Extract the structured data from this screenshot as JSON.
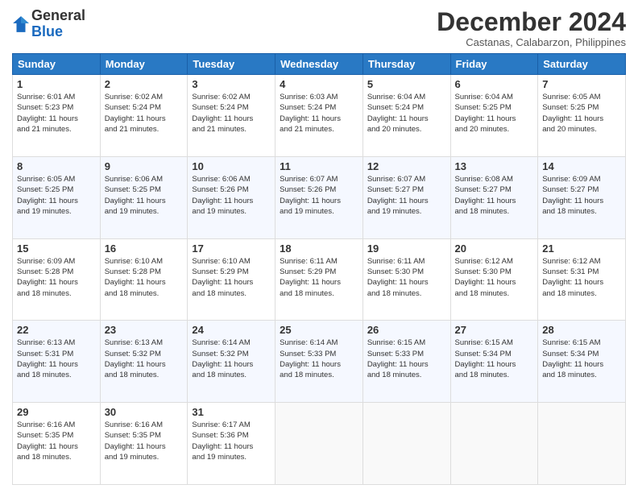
{
  "logo": {
    "general": "General",
    "blue": "Blue"
  },
  "title": "December 2024",
  "location": "Castanas, Calabarzon, Philippines",
  "header_days": [
    "Sunday",
    "Monday",
    "Tuesday",
    "Wednesday",
    "Thursday",
    "Friday",
    "Saturday"
  ],
  "weeks": [
    [
      {
        "day": "1",
        "info": "Sunrise: 6:01 AM\nSunset: 5:23 PM\nDaylight: 11 hours\nand 21 minutes."
      },
      {
        "day": "2",
        "info": "Sunrise: 6:02 AM\nSunset: 5:24 PM\nDaylight: 11 hours\nand 21 minutes."
      },
      {
        "day": "3",
        "info": "Sunrise: 6:02 AM\nSunset: 5:24 PM\nDaylight: 11 hours\nand 21 minutes."
      },
      {
        "day": "4",
        "info": "Sunrise: 6:03 AM\nSunset: 5:24 PM\nDaylight: 11 hours\nand 21 minutes."
      },
      {
        "day": "5",
        "info": "Sunrise: 6:04 AM\nSunset: 5:24 PM\nDaylight: 11 hours\nand 20 minutes."
      },
      {
        "day": "6",
        "info": "Sunrise: 6:04 AM\nSunset: 5:25 PM\nDaylight: 11 hours\nand 20 minutes."
      },
      {
        "day": "7",
        "info": "Sunrise: 6:05 AM\nSunset: 5:25 PM\nDaylight: 11 hours\nand 20 minutes."
      }
    ],
    [
      {
        "day": "8",
        "info": "Sunrise: 6:05 AM\nSunset: 5:25 PM\nDaylight: 11 hours\nand 19 minutes."
      },
      {
        "day": "9",
        "info": "Sunrise: 6:06 AM\nSunset: 5:25 PM\nDaylight: 11 hours\nand 19 minutes."
      },
      {
        "day": "10",
        "info": "Sunrise: 6:06 AM\nSunset: 5:26 PM\nDaylight: 11 hours\nand 19 minutes."
      },
      {
        "day": "11",
        "info": "Sunrise: 6:07 AM\nSunset: 5:26 PM\nDaylight: 11 hours\nand 19 minutes."
      },
      {
        "day": "12",
        "info": "Sunrise: 6:07 AM\nSunset: 5:27 PM\nDaylight: 11 hours\nand 19 minutes."
      },
      {
        "day": "13",
        "info": "Sunrise: 6:08 AM\nSunset: 5:27 PM\nDaylight: 11 hours\nand 18 minutes."
      },
      {
        "day": "14",
        "info": "Sunrise: 6:09 AM\nSunset: 5:27 PM\nDaylight: 11 hours\nand 18 minutes."
      }
    ],
    [
      {
        "day": "15",
        "info": "Sunrise: 6:09 AM\nSunset: 5:28 PM\nDaylight: 11 hours\nand 18 minutes."
      },
      {
        "day": "16",
        "info": "Sunrise: 6:10 AM\nSunset: 5:28 PM\nDaylight: 11 hours\nand 18 minutes."
      },
      {
        "day": "17",
        "info": "Sunrise: 6:10 AM\nSunset: 5:29 PM\nDaylight: 11 hours\nand 18 minutes."
      },
      {
        "day": "18",
        "info": "Sunrise: 6:11 AM\nSunset: 5:29 PM\nDaylight: 11 hours\nand 18 minutes."
      },
      {
        "day": "19",
        "info": "Sunrise: 6:11 AM\nSunset: 5:30 PM\nDaylight: 11 hours\nand 18 minutes."
      },
      {
        "day": "20",
        "info": "Sunrise: 6:12 AM\nSunset: 5:30 PM\nDaylight: 11 hours\nand 18 minutes."
      },
      {
        "day": "21",
        "info": "Sunrise: 6:12 AM\nSunset: 5:31 PM\nDaylight: 11 hours\nand 18 minutes."
      }
    ],
    [
      {
        "day": "22",
        "info": "Sunrise: 6:13 AM\nSunset: 5:31 PM\nDaylight: 11 hours\nand 18 minutes."
      },
      {
        "day": "23",
        "info": "Sunrise: 6:13 AM\nSunset: 5:32 PM\nDaylight: 11 hours\nand 18 minutes."
      },
      {
        "day": "24",
        "info": "Sunrise: 6:14 AM\nSunset: 5:32 PM\nDaylight: 11 hours\nand 18 minutes."
      },
      {
        "day": "25",
        "info": "Sunrise: 6:14 AM\nSunset: 5:33 PM\nDaylight: 11 hours\nand 18 minutes."
      },
      {
        "day": "26",
        "info": "Sunrise: 6:15 AM\nSunset: 5:33 PM\nDaylight: 11 hours\nand 18 minutes."
      },
      {
        "day": "27",
        "info": "Sunrise: 6:15 AM\nSunset: 5:34 PM\nDaylight: 11 hours\nand 18 minutes."
      },
      {
        "day": "28",
        "info": "Sunrise: 6:15 AM\nSunset: 5:34 PM\nDaylight: 11 hours\nand 18 minutes."
      }
    ],
    [
      {
        "day": "29",
        "info": "Sunrise: 6:16 AM\nSunset: 5:35 PM\nDaylight: 11 hours\nand 18 minutes."
      },
      {
        "day": "30",
        "info": "Sunrise: 6:16 AM\nSunset: 5:35 PM\nDaylight: 11 hours\nand 19 minutes."
      },
      {
        "day": "31",
        "info": "Sunrise: 6:17 AM\nSunset: 5:36 PM\nDaylight: 11 hours\nand 19 minutes."
      },
      {
        "day": "",
        "info": ""
      },
      {
        "day": "",
        "info": ""
      },
      {
        "day": "",
        "info": ""
      },
      {
        "day": "",
        "info": ""
      }
    ]
  ]
}
